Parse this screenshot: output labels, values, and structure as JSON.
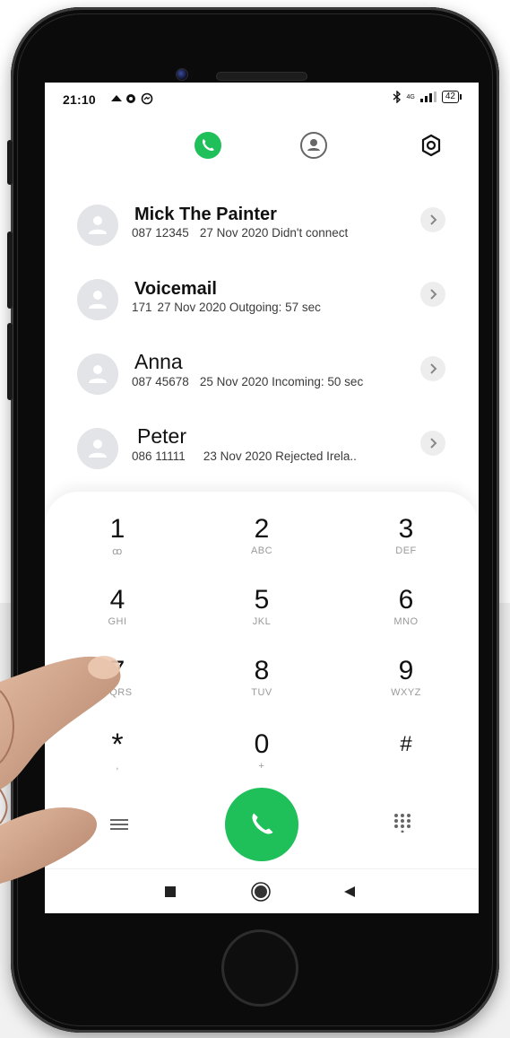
{
  "status_bar": {
    "time": "21:10",
    "battery": "42",
    "network": "4G"
  },
  "icons": {
    "tab_calls": "phone-icon",
    "tab_contacts": "contact-icon",
    "tab_settings": "settings-icon",
    "row_action": "chevron-right-icon",
    "menu": "menu-icon",
    "call": "phone-icon",
    "keypad": "keypad-icon"
  },
  "colors": {
    "accent": "#1fbf5a",
    "avatar_bg": "#e3e4e7",
    "letters": "#9a9a9a"
  },
  "calls": [
    {
      "name": "Mick The Painter",
      "number": "087 12345",
      "detail": "27 Nov 2020 Didn't connect"
    },
    {
      "name": "Voicemail",
      "number": "171",
      "detail": "27 Nov 2020 Outgoing: 57 sec"
    },
    {
      "name": "Anna",
      "number": "087 45678",
      "detail": "25 Nov 2020 Incoming: 50 sec"
    },
    {
      "name": "Peter",
      "number": "086 11111",
      "detail": "23 Nov 2020 Rejected  Irela.."
    }
  ],
  "keys": [
    {
      "digit": "1",
      "letters": "ꝏ"
    },
    {
      "digit": "2",
      "letters": "ABC"
    },
    {
      "digit": "3",
      "letters": "DEF"
    },
    {
      "digit": "4",
      "letters": "GHI"
    },
    {
      "digit": "5",
      "letters": "JKL"
    },
    {
      "digit": "6",
      "letters": "MNO"
    },
    {
      "digit": "7",
      "letters": "PQRS"
    },
    {
      "digit": "8",
      "letters": "TUV"
    },
    {
      "digit": "9",
      "letters": "WXYZ"
    },
    {
      "digit": "*",
      "letters": ","
    },
    {
      "digit": "0",
      "letters": "+"
    },
    {
      "digit": "#",
      "letters": ""
    }
  ]
}
